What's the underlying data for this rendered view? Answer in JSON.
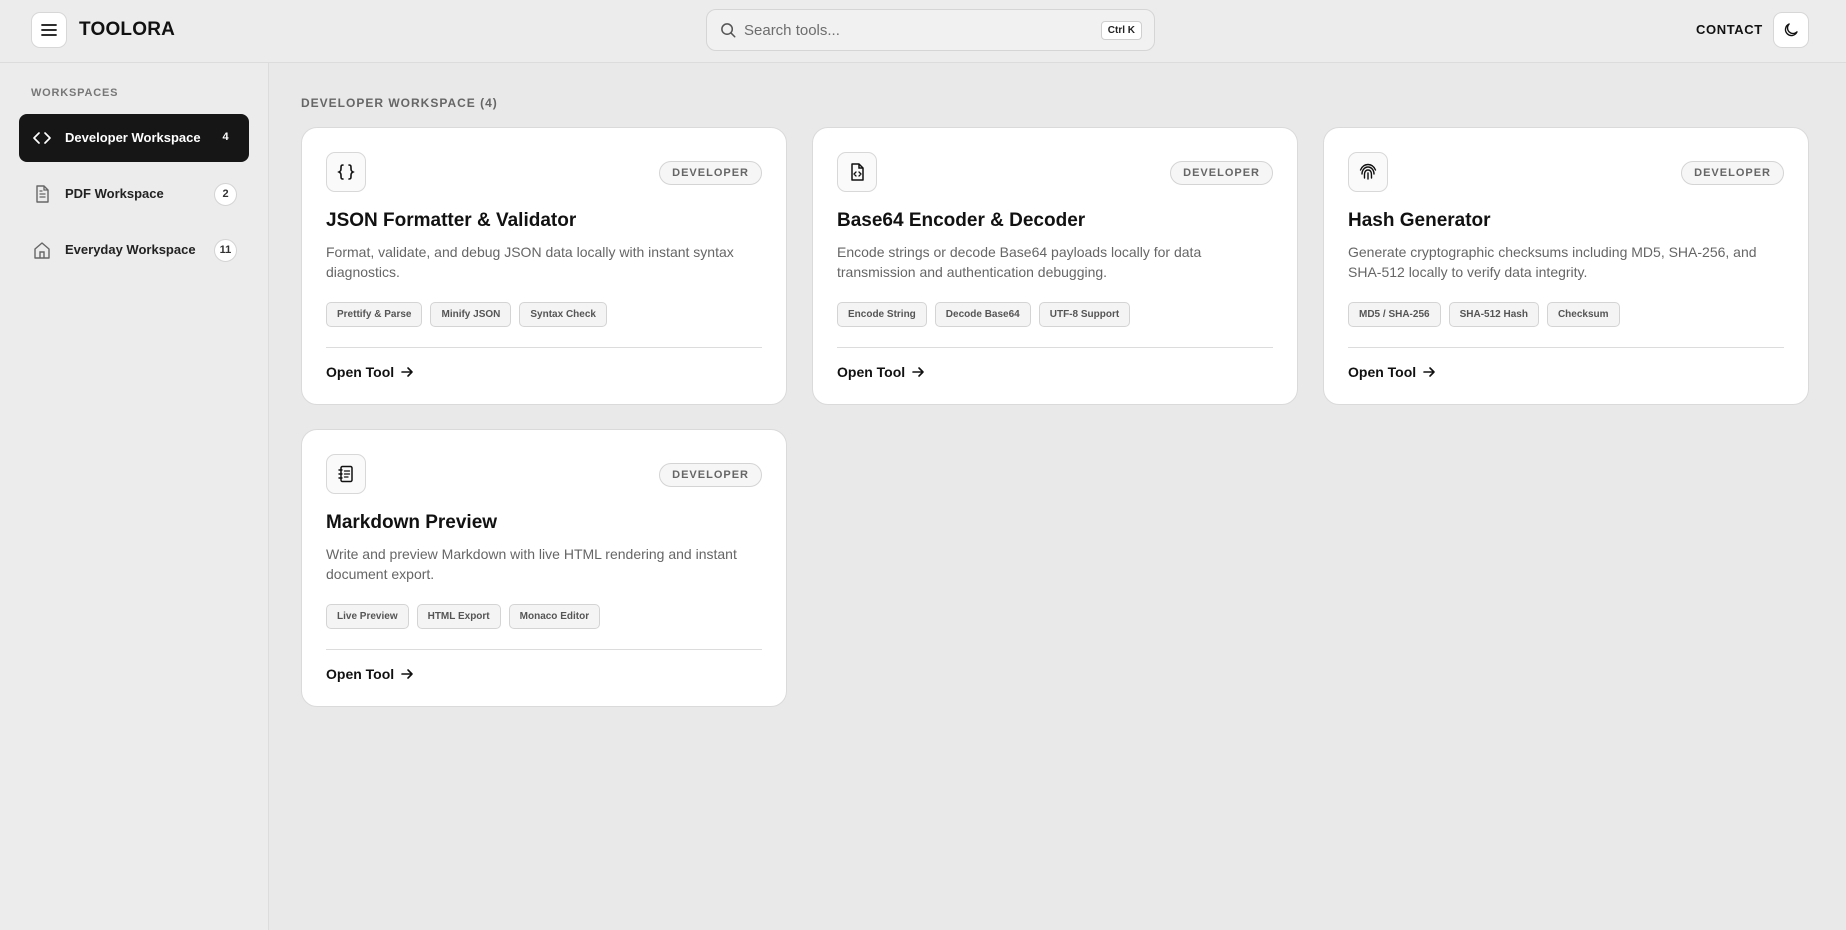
{
  "header": {
    "brand": "TOOLORA",
    "search_placeholder": "Search tools...",
    "shortcut": "Ctrl K",
    "contact_label": "CONTACT"
  },
  "sidebar": {
    "heading": "WORKSPACES",
    "items": [
      {
        "label": "Developer Workspace",
        "count": "4",
        "icon": "code-icon",
        "active": true
      },
      {
        "label": "PDF Workspace",
        "count": "2",
        "icon": "document-icon",
        "active": false
      },
      {
        "label": "Everyday Workspace",
        "count": "11",
        "icon": "home-icon",
        "active": false
      }
    ]
  },
  "main": {
    "section_title": "DEVELOPER WORKSPACE (4)",
    "cards": [
      {
        "icon": "braces-icon",
        "badge": "DEVELOPER",
        "title": "JSON Formatter & Validator",
        "description": "Format, validate, and debug JSON data locally with instant syntax diagnostics.",
        "chips": [
          "Prettify & Parse",
          "Minify JSON",
          "Syntax Check"
        ],
        "action": "Open Tool"
      },
      {
        "icon": "file-code-icon",
        "badge": "DEVELOPER",
        "title": "Base64 Encoder & Decoder",
        "description": "Encode strings or decode Base64 payloads locally for data transmission and authentication debugging.",
        "chips": [
          "Encode String",
          "Decode Base64",
          "UTF-8 Support"
        ],
        "action": "Open Tool"
      },
      {
        "icon": "fingerprint-icon",
        "badge": "DEVELOPER",
        "title": "Hash Generator",
        "description": "Generate cryptographic checksums including MD5, SHA-256, and SHA-512 locally to verify data integrity.",
        "chips": [
          "MD5 / SHA-256",
          "SHA-512 Hash",
          "Checksum"
        ],
        "action": "Open Tool"
      },
      {
        "icon": "notebook-icon",
        "badge": "DEVELOPER",
        "title": "Markdown Preview",
        "description": "Write and preview Markdown with live HTML rendering and instant document export.",
        "chips": [
          "Live Preview",
          "HTML Export",
          "Monaco Editor"
        ],
        "action": "Open Tool"
      }
    ]
  }
}
